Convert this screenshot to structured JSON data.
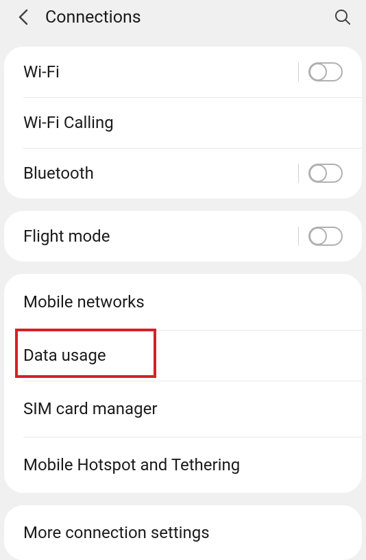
{
  "header": {
    "title": "Connections"
  },
  "group1": {
    "wifi": "Wi-Fi",
    "wifi_calling": "Wi-Fi Calling",
    "bluetooth": "Bluetooth"
  },
  "group2": {
    "flight_mode": "Flight mode"
  },
  "group3": {
    "mobile_networks": "Mobile networks",
    "data_usage": "Data usage",
    "sim_manager": "SIM card manager",
    "hotspot": "Mobile Hotspot and Tethering"
  },
  "group4": {
    "more": "More connection settings"
  },
  "highlight": {
    "target": "data_usage"
  }
}
